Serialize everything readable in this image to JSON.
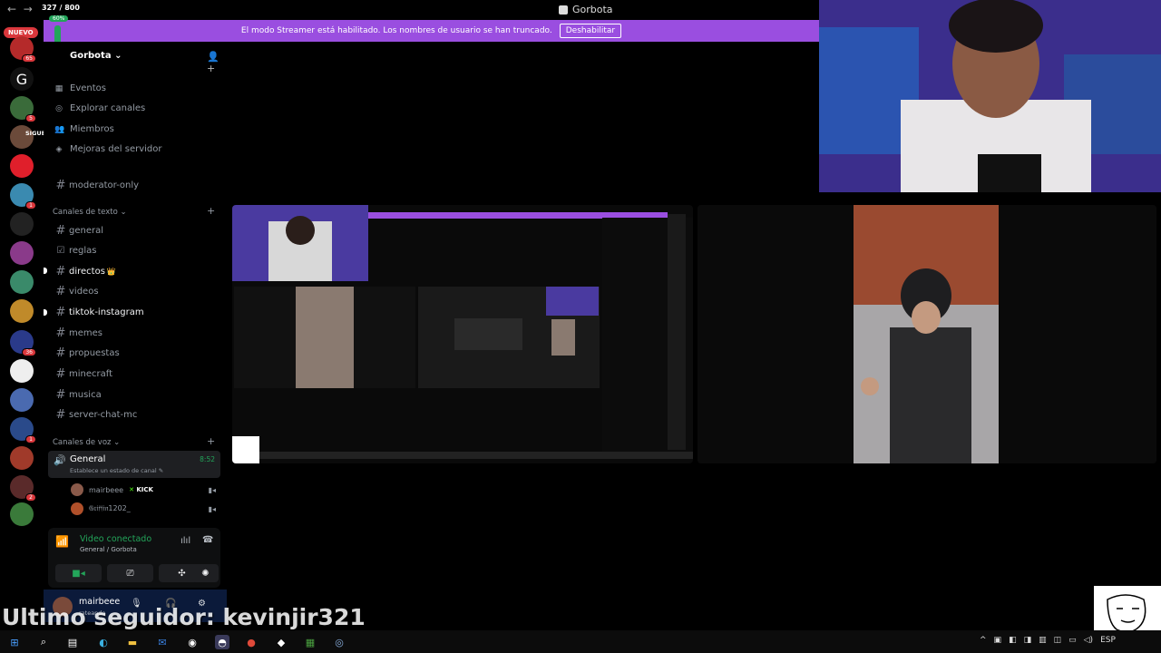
{
  "titlebar": {
    "back": "←",
    "forward": "→",
    "counter": "327 / 800",
    "app_title": "Gorbota"
  },
  "banner": {
    "text": "El modo Streamer está habilitado. Los nombres de usuario se han truncado.",
    "button": "Deshabilitar"
  },
  "rail": {
    "nuevo": "NUEVO",
    "percent": "60%",
    "badges": [
      "65",
      "5",
      "1",
      "2",
      "1",
      "36",
      "1",
      "2"
    ],
    "follow_text": "SIGUEME SOMOS:"
  },
  "server": {
    "name": "Gorbota",
    "nav": [
      {
        "label": "Eventos",
        "icon": "calendar-icon"
      },
      {
        "label": "Explorar canales",
        "icon": "compass-icon"
      },
      {
        "label": "Miembros",
        "icon": "members-icon"
      },
      {
        "label": "Mejoras del servidor",
        "icon": "boost-icon"
      }
    ],
    "top_channel": "moderator-only",
    "text_category": "Canales de texto",
    "text_channels": [
      {
        "label": "general",
        "icon": "#"
      },
      {
        "label": "reglas",
        "icon": "☑"
      },
      {
        "label": "directos",
        "icon": "#",
        "suffix": "👑"
      },
      {
        "label": "videos",
        "icon": "#"
      },
      {
        "label": "tiktok-instagram",
        "icon": "#"
      },
      {
        "label": "memes",
        "icon": "#"
      },
      {
        "label": "propuestas",
        "icon": "#"
      },
      {
        "label": "minecraft",
        "icon": "#"
      },
      {
        "label": "musica",
        "icon": "#"
      },
      {
        "label": "server-chat-mc",
        "icon": "#"
      }
    ],
    "voice_category": "Canales de voz",
    "voice_channel": {
      "name": "General",
      "status": "Establece un estado de canal",
      "time": "8:52"
    },
    "voice_users": [
      {
        "name": "mairbeee",
        "tag": "KICK"
      },
      {
        "name": "𝔊𝔯𝔦𝔣𝔣𝔦𝔫1202_",
        "tag": ""
      }
    ]
  },
  "voice_panel": {
    "status": "Video conectado",
    "location": "General / Gorbota"
  },
  "user_panel": {
    "username": "mairbeee",
    "status": "rateando"
  },
  "overlay": {
    "follower": "Ultimo seguidor: kevinjir321"
  },
  "taskbar": {
    "lang": "ESP",
    "pinned": [
      "windows-icon",
      "search-icon",
      "taskview-icon",
      "edge-icon",
      "explorer-icon",
      "mail-icon",
      "obs-icon",
      "discord-icon",
      "chrome-icon",
      "app-icon",
      "minecraft-icon",
      "steam-icon"
    ]
  },
  "colors": {
    "banner": "#9a4ee0",
    "online": "#23a55a",
    "badge": "#da373c"
  }
}
